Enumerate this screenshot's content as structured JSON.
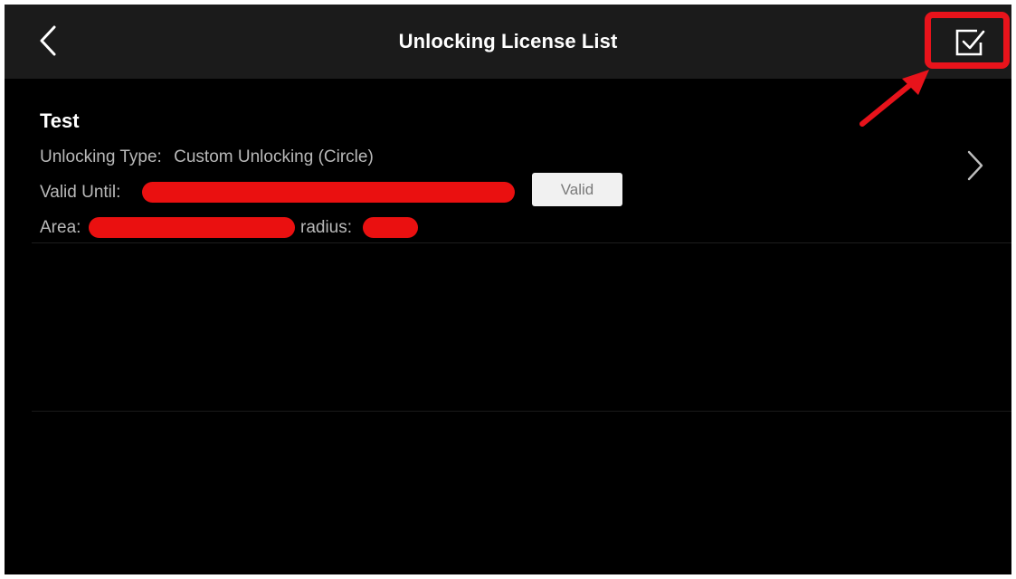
{
  "header": {
    "title": "Unlocking License List",
    "back_icon": "chevron-left-icon",
    "select_icon": "checkbox-icon"
  },
  "licenses": [
    {
      "name": "Test",
      "type_label": "Unlocking Type:",
      "type_value": "Custom Unlocking (Circle)",
      "valid_until_label": "Valid Until:",
      "status": "Valid",
      "area_label": "Area:",
      "radius_label": "radius:"
    }
  ],
  "annotation": {
    "color": "#e8131b"
  },
  "colors": {
    "background": "#000000",
    "topbar": "#1b1b1b",
    "redaction": "#ea1010"
  }
}
